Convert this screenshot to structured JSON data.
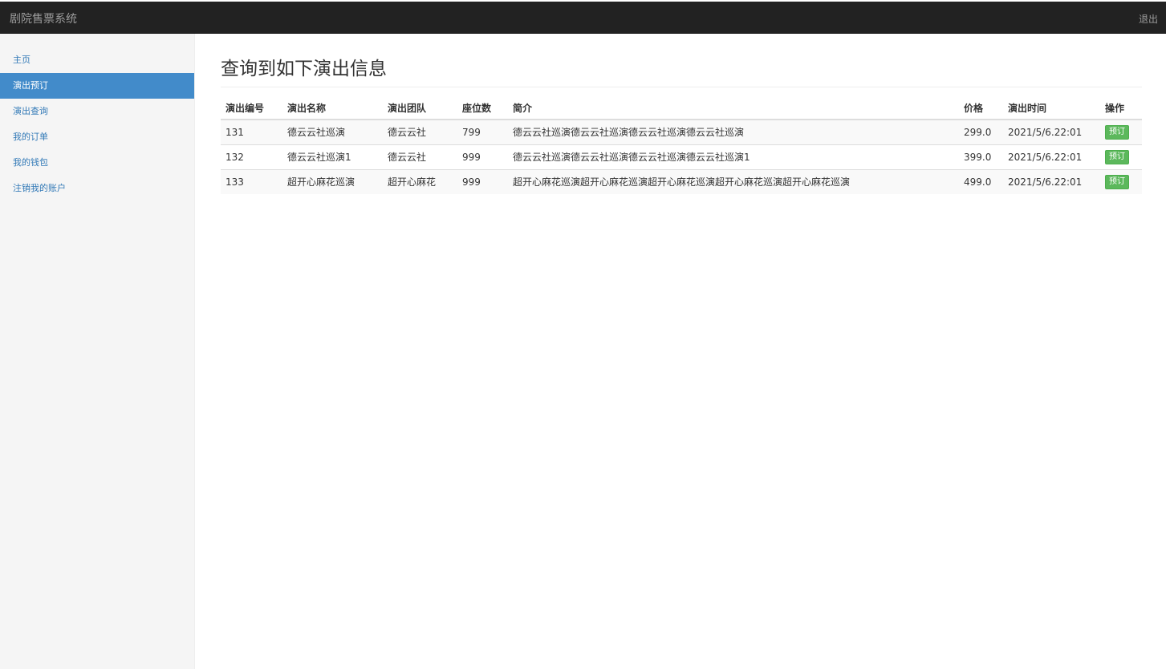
{
  "navbar": {
    "brand": "剧院售票系统",
    "logout_label": "退出"
  },
  "sidebar": {
    "items": [
      {
        "label": "主页",
        "active": false
      },
      {
        "label": "演出预订",
        "active": true
      },
      {
        "label": "演出查询",
        "active": false
      },
      {
        "label": "我的订单",
        "active": false
      },
      {
        "label": "我的钱包",
        "active": false
      },
      {
        "label": "注销我的账户",
        "active": false
      }
    ]
  },
  "main": {
    "title": "查询到如下演出信息",
    "table": {
      "headers": [
        "演出编号",
        "演出名称",
        "演出团队",
        "座位数",
        "简介",
        "价格",
        "演出时间",
        "操作"
      ],
      "rows": [
        {
          "id": "131",
          "name": "德云云社巡演",
          "team": "德云云社",
          "seats": "799",
          "intro": "德云云社巡演德云云社巡演德云云社巡演德云云社巡演",
          "price": "299.0",
          "time": "2021/5/6.22:01",
          "action": "预订"
        },
        {
          "id": "132",
          "name": "德云云社巡演1",
          "team": "德云云社",
          "seats": "999",
          "intro": "德云云社巡演德云云社巡演德云云社巡演德云云社巡演1",
          "price": "399.0",
          "time": "2021/5/6.22:01",
          "action": "预订"
        },
        {
          "id": "133",
          "name": "超开心麻花巡演",
          "team": "超开心麻花",
          "seats": "999",
          "intro": "超开心麻花巡演超开心麻花巡演超开心麻花巡演超开心麻花巡演超开心麻花巡演",
          "price": "499.0",
          "time": "2021/5/6.22:01",
          "action": "预订"
        }
      ]
    }
  },
  "colors": {
    "navbar_bg": "#222222",
    "sidebar_active": "#428bca",
    "link": "#337ab7",
    "book_button": "#5cb85c"
  }
}
